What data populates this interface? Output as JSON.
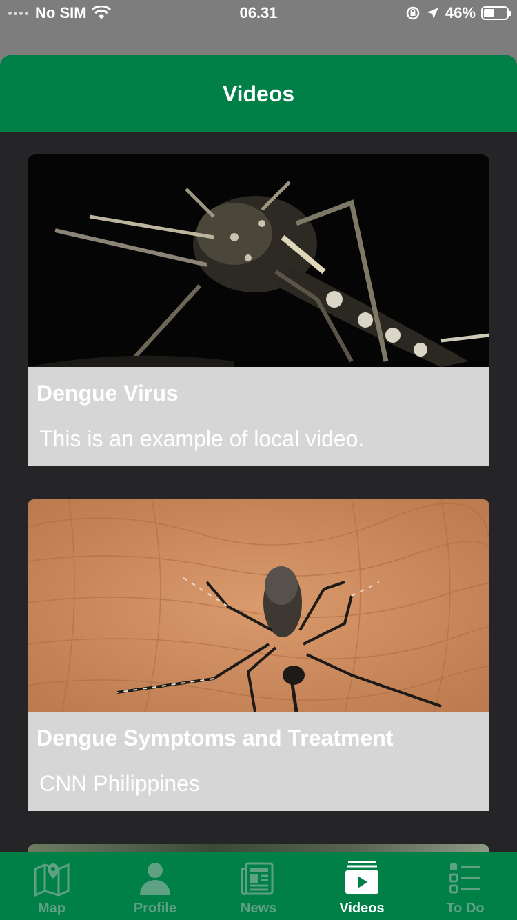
{
  "status_bar": {
    "carrier": "No SIM",
    "time": "06.31",
    "battery": "46%",
    "battery_level": 0.46
  },
  "header": {
    "title": "Videos"
  },
  "videos": [
    {
      "title": "Dengue Virus",
      "subtitle": "This is an example of local video.",
      "thumbnail": "mosquito-closeup-image"
    },
    {
      "title": "Dengue Symptoms and Treatment",
      "subtitle": "CNN Philippines",
      "thumbnail": "mosquito-on-skin-image"
    }
  ],
  "tabs": [
    {
      "label": "Map",
      "icon": "map-icon",
      "active": false
    },
    {
      "label": "Profile",
      "icon": "person-icon",
      "active": false
    },
    {
      "label": "News",
      "icon": "newspaper-icon",
      "active": false
    },
    {
      "label": "Videos",
      "icon": "video-icon",
      "active": true
    },
    {
      "label": "To Do",
      "icon": "checklist-icon",
      "active": false
    }
  ],
  "colors": {
    "brand_green": "#007f47",
    "background": "#252527",
    "card_body": "#d6d6d6",
    "tab_inactive": "#5fa183"
  }
}
